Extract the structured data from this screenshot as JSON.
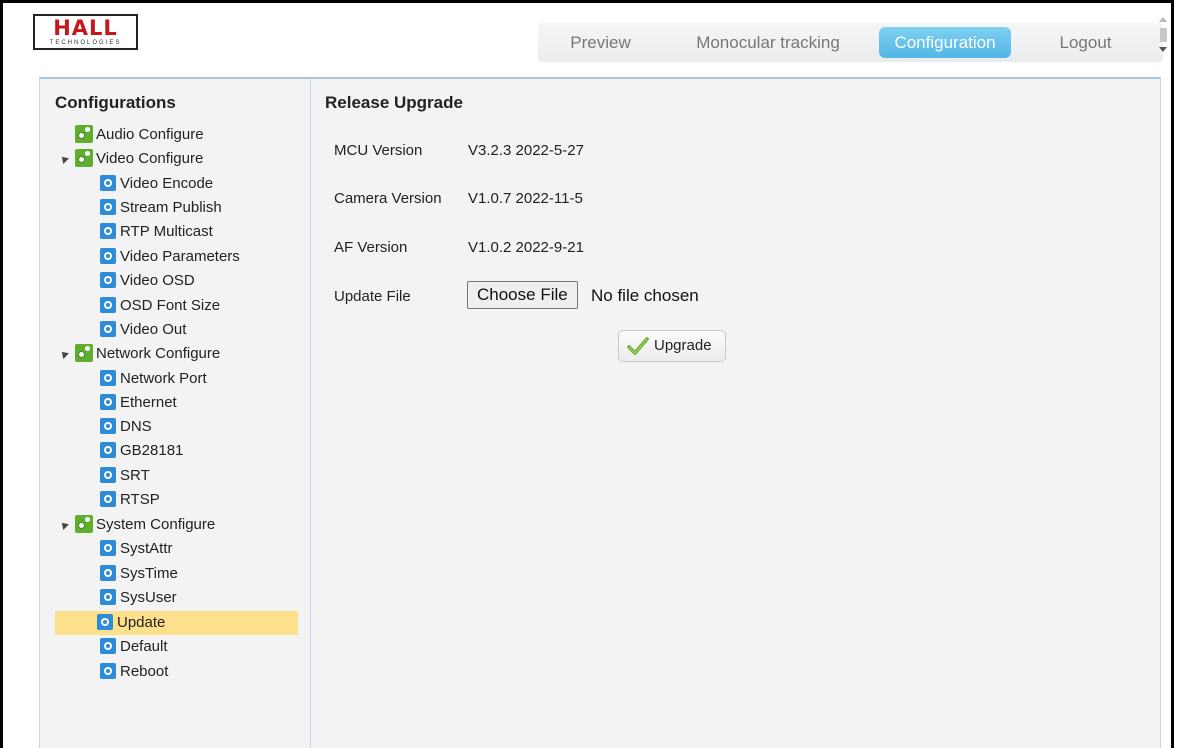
{
  "logo": {
    "text": "HALL",
    "subtext": "TECHNOLOGIES"
  },
  "nav": {
    "items": [
      {
        "label": "Preview"
      },
      {
        "label": "Monocular tracking"
      },
      {
        "label": "Configuration"
      },
      {
        "label": "Logout"
      }
    ],
    "active": "Configuration",
    "active_color": "#5cbbe9"
  },
  "sidebar": {
    "title": "Configurations",
    "groups": [
      {
        "label": "Audio Configure",
        "items": []
      },
      {
        "label": "Video Configure",
        "items": [
          "Video Encode",
          "Stream Publish",
          "RTP Multicast",
          "Video Parameters",
          "Video OSD",
          "OSD Font Size",
          "Video Out"
        ]
      },
      {
        "label": "Network Configure",
        "items": [
          "Network Port",
          "Ethernet",
          "DNS",
          "GB28181",
          "SRT",
          "RTSP"
        ]
      },
      {
        "label": "System Configure",
        "items": [
          "SystAttr",
          "SysTime",
          "SysUser",
          "Update",
          "Default",
          "Reboot"
        ]
      }
    ],
    "selected": "Update",
    "selected_color": "#fde08c"
  },
  "content": {
    "title": "Release Upgrade",
    "mcu_label": "MCU Version",
    "mcu_value": "V3.2.3 2022-5-27",
    "camera_label": "Camera Version",
    "camera_value": "V1.0.7 2022-11-5",
    "af_label": "AF Version",
    "af_value": "V1.0.2 2022-9-21",
    "update_label": "Update File",
    "choose_file": "Choose File",
    "file_status": "No file chosen",
    "upgrade_button": "Upgrade"
  }
}
